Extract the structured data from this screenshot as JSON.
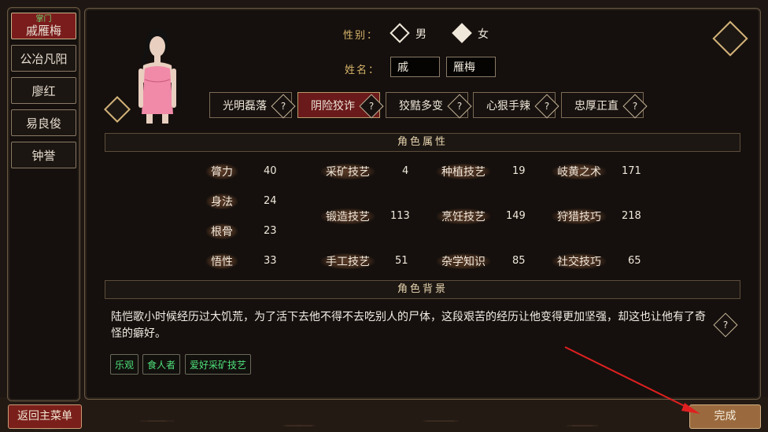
{
  "sidebar": {
    "items": [
      {
        "tag": "掌门",
        "label": "戚雁梅",
        "active": true
      },
      {
        "label": "公冶凡阳"
      },
      {
        "label": "廖红"
      },
      {
        "label": "易良俊"
      },
      {
        "label": "钟誉"
      }
    ]
  },
  "form": {
    "gender_label": "性别：",
    "gender_male": "男",
    "gender_female": "女",
    "name_label": "姓名：",
    "surname": "戚",
    "given_name": "雁梅"
  },
  "traits": [
    "光明磊落",
    "阴险狡诈",
    "狡黠多变",
    "心狠手辣",
    "忠厚正直"
  ],
  "traits_help": "?",
  "attributes_title": "角色属性",
  "attributes": {
    "col1": [
      {
        "name": "膂力",
        "value": "40"
      },
      {
        "name": "身法",
        "value": "24"
      },
      {
        "name": "根骨",
        "value": "23"
      },
      {
        "name": "悟性",
        "value": "33"
      }
    ],
    "skills": [
      {
        "name": "采矿技艺",
        "value": "4"
      },
      {
        "name": "种植技艺",
        "value": "19"
      },
      {
        "name": "岐黄之术",
        "value": "171"
      },
      {
        "name": "锻造技艺",
        "value": "113"
      },
      {
        "name": "烹饪技艺",
        "value": "149"
      },
      {
        "name": "狩猎技巧",
        "value": "218"
      },
      {
        "name": "手工技艺",
        "value": "51"
      },
      {
        "name": "杂学知识",
        "value": "85"
      },
      {
        "name": "社交技巧",
        "value": "65"
      }
    ]
  },
  "background_title": "角色背景",
  "background_text": "陆恺歌小时候经历过大饥荒，为了活下去他不得不去吃别人的尸体，这段艰苦的经历让他变得更加坚强，却这也让他有了奇怪的癖好。",
  "tags": [
    "乐观",
    "食人者",
    "爱好采矿技艺"
  ],
  "buttons": {
    "back": "返回主菜单",
    "done": "完成"
  },
  "colors": {
    "accent_red": "#7a1f1a",
    "gold": "#d8b56b",
    "tag_green": "#4ee07a",
    "done": "#9a6a3e"
  }
}
